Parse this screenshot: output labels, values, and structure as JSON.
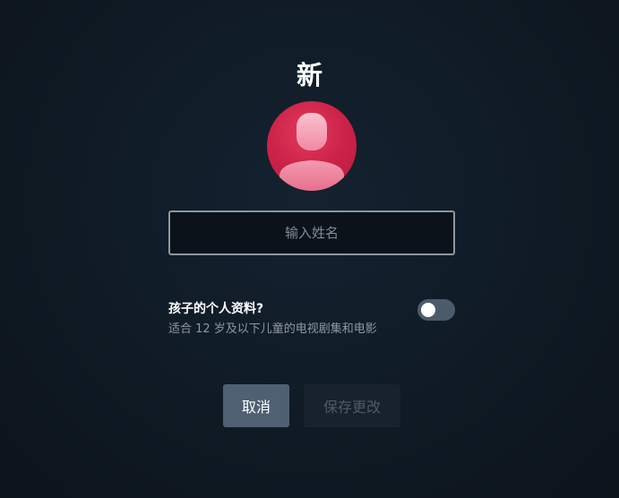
{
  "header": {
    "title": "新"
  },
  "avatar": {
    "icon": "user-silhouette-icon",
    "color": "#cc2249"
  },
  "name_field": {
    "placeholder": "输入姓名",
    "value": ""
  },
  "kids_profile": {
    "label": "孩子的个人资料?",
    "description": "适合 12 岁及以下儿童的电视剧集和电影",
    "enabled": false
  },
  "actions": {
    "cancel_label": "取消",
    "save_label": "保存更改"
  },
  "colors": {
    "background": "#0f1922",
    "avatar_red": "#cc2249",
    "cancel_button": "#4f6073",
    "save_button_disabled": "#17222d"
  }
}
